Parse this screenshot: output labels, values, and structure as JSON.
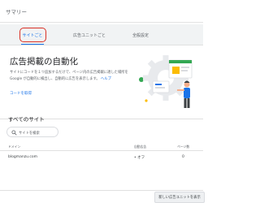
{
  "header": {
    "title": "サマリー"
  },
  "tabs": [
    {
      "label": "サイトごと",
      "active": true
    },
    {
      "label": "広告ユニットごと",
      "active": false
    },
    {
      "label": "全般設定",
      "active": false
    }
  ],
  "auto_ads_card": {
    "title": "広告掲載の自動化",
    "description": "サイトにコードを１つ追加するだけで、ページ内の広告掲載に適した場所を Google が自動的に検出し、自動的に広告を表示します。",
    "help_link": "ヘルプ",
    "code_link": "コードを取得"
  },
  "sites_section": {
    "title": "すべてのサイト",
    "search_placeholder": "サイトを検索"
  },
  "table": {
    "columns": {
      "domain": "ドメイン",
      "auto_ads": "自動広告",
      "pages": "ページ数"
    },
    "rows": [
      {
        "domain": "blogmanzu.com",
        "auto_ads": "• オフ",
        "pages": "0"
      }
    ]
  },
  "footer": {
    "button_label": "新しい広告ユニットを表示"
  },
  "colors": {
    "accent": "#1a73e8",
    "highlight": "#d93025",
    "tab_bar": "#f1f3f4"
  }
}
